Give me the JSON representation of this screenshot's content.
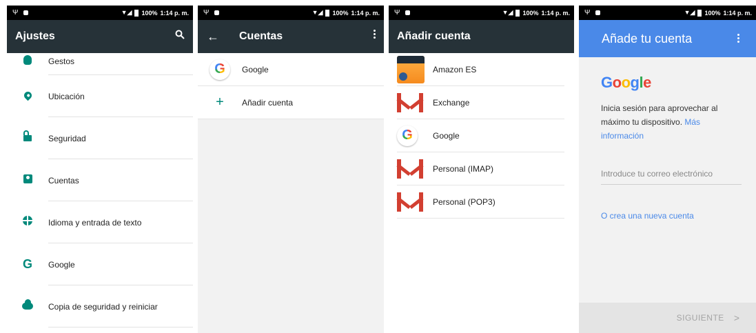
{
  "status": {
    "battery": "100%",
    "time": "1:14 p. m."
  },
  "screen1": {
    "title": "Ajustes",
    "icon": "search-icon",
    "items": [
      {
        "label": "Gestos",
        "icon": "gesture-icon"
      },
      {
        "label": "Ubicación",
        "icon": "location-icon"
      },
      {
        "label": "Seguridad",
        "icon": "lock-icon"
      },
      {
        "label": "Cuentas",
        "icon": "account-icon"
      },
      {
        "label": "Idioma y entrada de texto",
        "icon": "globe-icon"
      },
      {
        "label": "Google",
        "icon": "google-icon"
      },
      {
        "label": "Copia de seguridad y reiniciar",
        "icon": "cloud-backup-icon"
      }
    ]
  },
  "screen2": {
    "title": "Cuentas",
    "items": [
      {
        "label": "Google",
        "icon": "google-logo-icon"
      },
      {
        "label": "Añadir cuenta",
        "icon": "plus-icon"
      }
    ]
  },
  "screen3": {
    "title": "Añadir cuenta",
    "items": [
      {
        "label": "Amazon ES",
        "icon": "amazon-apps-icon"
      },
      {
        "label": "Exchange",
        "icon": "gmail-icon"
      },
      {
        "label": "Google",
        "icon": "google-logo-icon"
      },
      {
        "label": "Personal (IMAP)",
        "icon": "gmail-icon"
      },
      {
        "label": "Personal (POP3)",
        "icon": "gmail-icon"
      }
    ]
  },
  "screen4": {
    "title": "Añade tu cuenta",
    "logo": "Google",
    "description": "Inicia sesión para aprovechar al máximo tu dispositivo.",
    "more_info_link": "Más información",
    "email_placeholder": "Introduce tu correo electrónico",
    "create_account_link": "O crea una nueva cuenta",
    "next_button": "SIGUIENTE"
  },
  "colors": {
    "toolbar": "#263238",
    "accent_teal": "#00897b",
    "google_blue_bar": "#4a89e8"
  }
}
